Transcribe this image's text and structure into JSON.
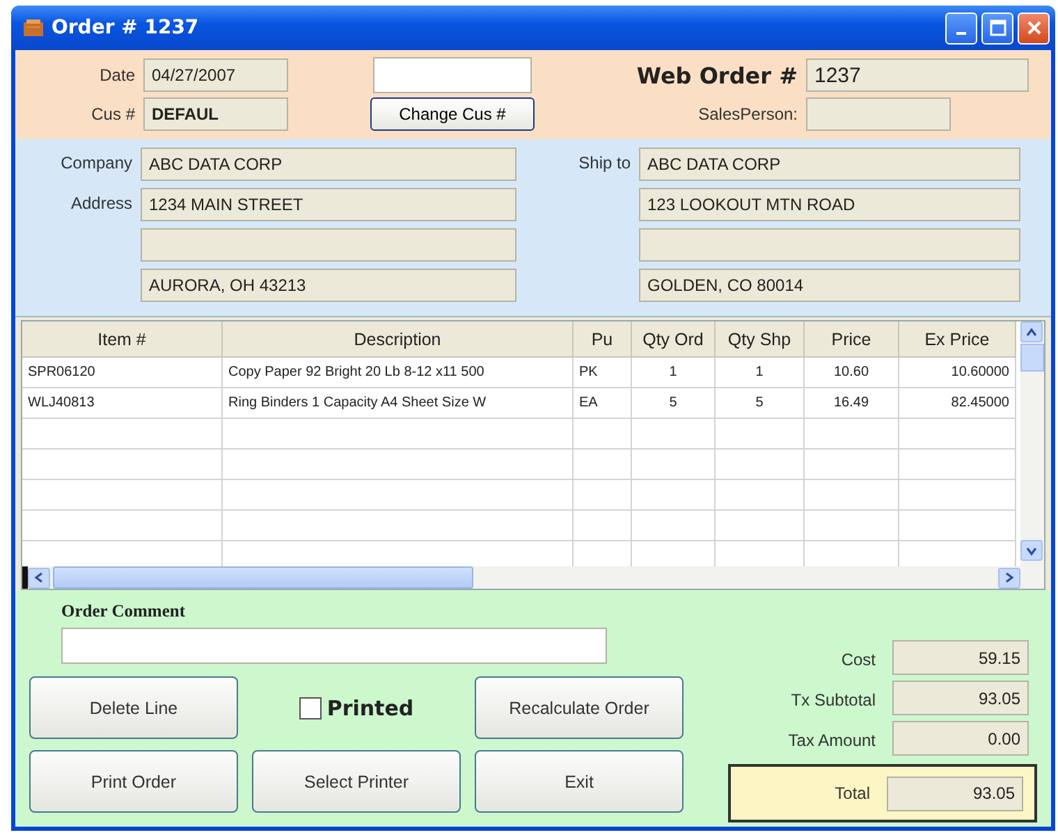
{
  "window": {
    "title": "Order # 1237"
  },
  "header": {
    "date_label": "Date",
    "date": "04/27/2007",
    "customer_label": "Cus #",
    "customer": "DEFAUL",
    "change_button": "Change Cus #",
    "web_order_label": "Web Order #",
    "web_order": "1237",
    "salesperson_label": "SalesPerson:"
  },
  "bill_to": {
    "company_label": "Company",
    "address_label": "Address",
    "company": "ABC DATA CORP",
    "street": "1234 MAIN STREET",
    "city": "AURORA, OH  43213"
  },
  "ship_to": {
    "label": "Ship to",
    "company": "ABC DATA CORP",
    "street": "123 LOOKOUT MTN ROAD",
    "city": "GOLDEN, CO  80014"
  },
  "table": {
    "columns": [
      "Item #",
      "Description",
      "Pu",
      "Qty Ord",
      "Qty Shp",
      "Price",
      "Ex Price"
    ],
    "rows": [
      [
        "SPR06120",
        "Copy Paper 92 Bright 20 Lb 8-12 x11 500",
        "PK",
        "1",
        "1",
        "10.60",
        "10.60000"
      ],
      [
        "WLJ40813",
        "Ring Binders 1 Capacity A4 Sheet Size W",
        "EA",
        "5",
        "5",
        "16.49",
        "82.45000"
      ]
    ]
  },
  "comment": {
    "label": "Order Comment"
  },
  "printed": {
    "label": "Printed",
    "checked": false
  },
  "buttons": [
    "Delete Line",
    "Recalculate Order",
    "Print Order",
    "Select Printer",
    "Exit"
  ],
  "totals": [
    {
      "label": "Cost",
      "value": "59.15"
    },
    {
      "label": "Tx Subtotal",
      "value": "93.05"
    },
    {
      "label": "Tax Amount",
      "value": "0.00"
    }
  ],
  "total": {
    "label": "Total",
    "value": "93.05"
  }
}
